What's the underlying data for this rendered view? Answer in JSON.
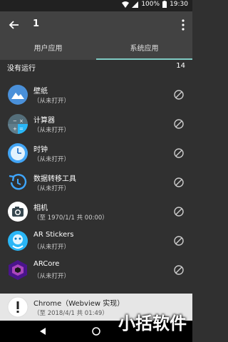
{
  "status": {
    "battery": "100%",
    "time": "19:30"
  },
  "appbar": {
    "title": "1"
  },
  "tabs": [
    {
      "label": "用户应用"
    },
    {
      "label": "系统应用"
    }
  ],
  "subheader": {
    "label": "没有运行",
    "count": "14"
  },
  "items": [
    {
      "name": "壁纸",
      "sub": "（从未打开）"
    },
    {
      "name": "计算器",
      "sub": "（从未打开）"
    },
    {
      "name": "时钟",
      "sub": "（从未打开）"
    },
    {
      "name": "数据转移工具",
      "sub": "（从未打开）"
    },
    {
      "name": "相机",
      "sub": "（至 1970/1/1 共 00:00）"
    },
    {
      "name": "AR Stickers",
      "sub": "（从未打开）"
    },
    {
      "name": "ARCore",
      "sub": "（从未打开）"
    }
  ],
  "last": {
    "name": "Chrome（Webview 实现）",
    "sub": "（至 2018/4/1 共 01:49）"
  },
  "watermark": "小括软件"
}
